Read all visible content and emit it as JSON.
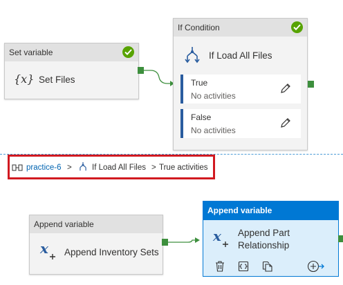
{
  "set_variable": {
    "header": "Set variable",
    "title": "Set Files",
    "icon_glyph": "{x}",
    "icon": "variable-braces-icon",
    "status": "succeeded"
  },
  "if_condition": {
    "header": "If Condition",
    "title": "If Load All Files",
    "icon": "condition-branch-icon",
    "status": "succeeded",
    "branches": [
      {
        "label": "True",
        "sub": "No activities"
      },
      {
        "label": "False",
        "sub": "No activities"
      }
    ]
  },
  "breadcrumb": {
    "pipeline": "practice-6",
    "sep1": ">",
    "activity": "If Load All Files",
    "sep2": ">",
    "current": "True activities"
  },
  "append_inventory": {
    "header": "Append variable",
    "title": "Append Inventory Sets",
    "icon": "append-variable-icon"
  },
  "append_part": {
    "header": "Append variable",
    "title_line1": "Append Part",
    "title_line2": "Relationship",
    "icon": "append-variable-icon",
    "actions": [
      "delete-icon",
      "code-icon",
      "copy-icon",
      "add-connection-icon"
    ]
  },
  "colors": {
    "accent": "#0078d4",
    "success": "#57a300",
    "port": "#3d8f3d",
    "highlight": "#d11920",
    "link": "#0063b1"
  }
}
